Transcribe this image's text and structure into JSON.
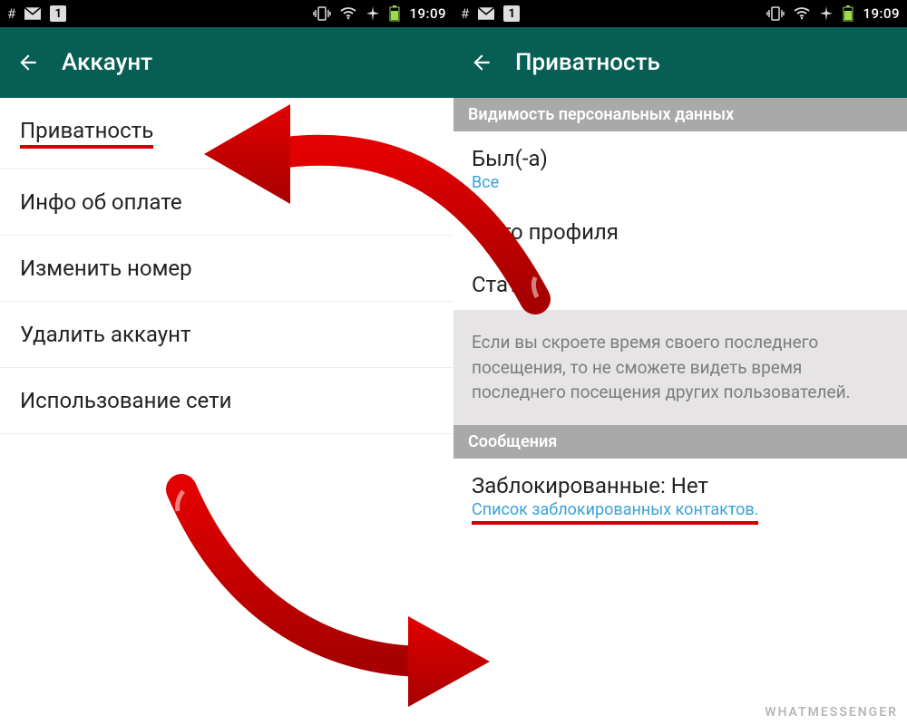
{
  "status_bar": {
    "time": "19:09",
    "hash": "#",
    "one_badge": "1"
  },
  "left": {
    "title": "Аккаунт",
    "items": [
      "Приватность",
      "Инфо об оплате",
      "Изменить номер",
      "Удалить аккаунт",
      "Использование сети"
    ]
  },
  "right": {
    "title": "Приватность",
    "section_visibility": "Видимость персональных данных",
    "last_seen": {
      "title": "Был(-а)",
      "value": "Все"
    },
    "profile_photo": {
      "title": "Фото профиля"
    },
    "status": {
      "title": "Статус"
    },
    "info_text": "Если вы скроете время своего последнего посещения, то не сможете видеть время последнего посещения других пользователей.",
    "section_messages": "Сообщения",
    "blocked": {
      "title": "Заблокированные: Нет",
      "sub": "Список заблокированных контактов."
    }
  },
  "watermark": "WHATMESSENGER"
}
